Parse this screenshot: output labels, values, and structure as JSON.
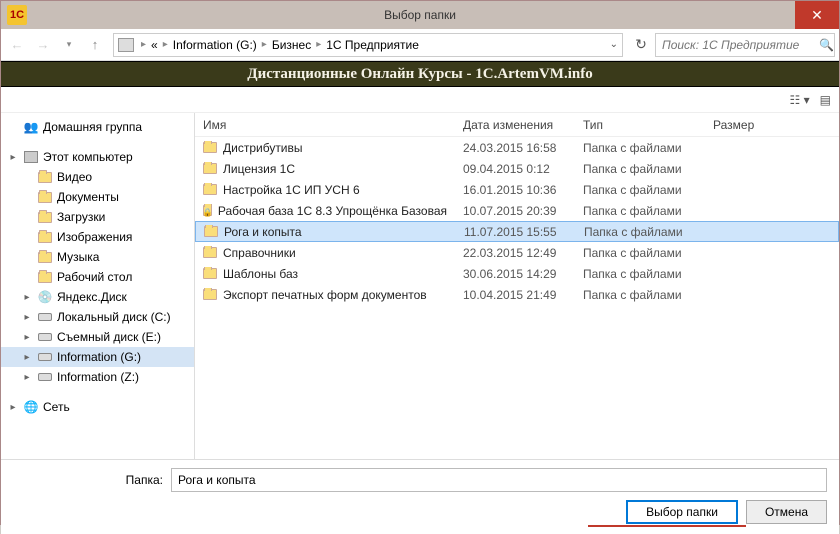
{
  "titlebar": {
    "title": "Выбор папки"
  },
  "breadcrumb": {
    "parts": [
      "Information (G:)",
      "Бизнес",
      "1С Предприятие"
    ]
  },
  "search": {
    "placeholder": "Поиск: 1С Предприятие"
  },
  "banner": "Дистанционные Онлайн Курсы - 1C.ArtemVM.info",
  "sidebar": {
    "items": [
      {
        "label": "Домашняя группа",
        "icon": "homegroup",
        "level": 0,
        "expand": ""
      },
      {
        "label": "",
        "spacer": true
      },
      {
        "label": "Этот компьютер",
        "icon": "computer",
        "level": 0,
        "expand": "▸"
      },
      {
        "label": "Видео",
        "icon": "folder-blue",
        "level": 1,
        "expand": ""
      },
      {
        "label": "Документы",
        "icon": "folder-blue",
        "level": 1,
        "expand": ""
      },
      {
        "label": "Загрузки",
        "icon": "folder-blue",
        "level": 1,
        "expand": ""
      },
      {
        "label": "Изображения",
        "icon": "folder-blue",
        "level": 1,
        "expand": ""
      },
      {
        "label": "Музыка",
        "icon": "folder-blue",
        "level": 1,
        "expand": ""
      },
      {
        "label": "Рабочий стол",
        "icon": "folder-blue",
        "level": 1,
        "expand": ""
      },
      {
        "label": "Яндекс.Диск",
        "icon": "disk-yandex",
        "level": 1,
        "expand": "▸"
      },
      {
        "label": "Локальный диск (C:)",
        "icon": "drive",
        "level": 1,
        "expand": "▸"
      },
      {
        "label": "Съемный диск (E:)",
        "icon": "drive-removable",
        "level": 1,
        "expand": "▸"
      },
      {
        "label": "Information (G:)",
        "icon": "drive",
        "level": 1,
        "expand": "▸",
        "selected": true
      },
      {
        "label": "Information (Z:)",
        "icon": "drive",
        "level": 1,
        "expand": "▸"
      },
      {
        "label": "",
        "spacer": true
      },
      {
        "label": "Сеть",
        "icon": "network",
        "level": 0,
        "expand": "▸"
      }
    ]
  },
  "columns": {
    "name": "Имя",
    "date": "Дата изменения",
    "type": "Тип",
    "size": "Размер"
  },
  "files": [
    {
      "name": "Дистрибутивы",
      "date": "24.03.2015 16:58",
      "type": "Папка с файлами",
      "icon": "folder"
    },
    {
      "name": "Лицензия 1С",
      "date": "09.04.2015 0:12",
      "type": "Папка с файлами",
      "icon": "folder"
    },
    {
      "name": "Настройка 1С ИП УСН 6",
      "date": "16.01.2015 10:36",
      "type": "Папка с файлами",
      "icon": "folder"
    },
    {
      "name": "Рабочая база 1С 8.3 Упрощёнка Базовая",
      "date": "10.07.2015 20:39",
      "type": "Папка с файлами",
      "icon": "folder-locked"
    },
    {
      "name": "Рога и копыта",
      "date": "11.07.2015 15:55",
      "type": "Папка с файлами",
      "icon": "folder",
      "selected": true
    },
    {
      "name": "Справочники",
      "date": "22.03.2015 12:49",
      "type": "Папка с файлами",
      "icon": "folder"
    },
    {
      "name": "Шаблоны баз",
      "date": "30.06.2015 14:29",
      "type": "Папка с файлами",
      "icon": "folder"
    },
    {
      "name": "Экспорт печатных форм документов",
      "date": "10.04.2015 21:49",
      "type": "Папка с файлами",
      "icon": "folder"
    }
  ],
  "footer": {
    "label": "Папка:",
    "value": "Рога и копыта",
    "select_btn": "Выбор папки",
    "cancel_btn": "Отмена"
  }
}
